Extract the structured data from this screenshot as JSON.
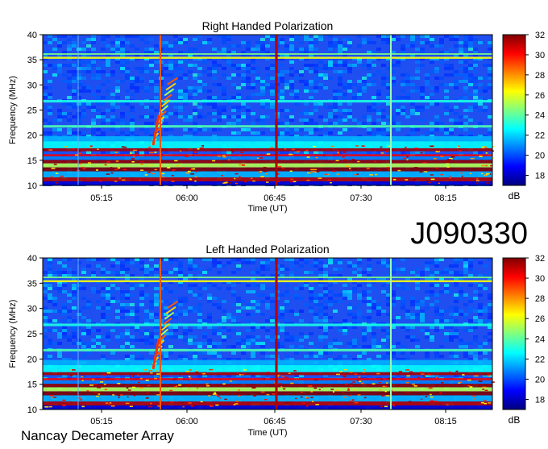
{
  "chart_data": [
    {
      "type": "heatmap",
      "title": "Right Handed Polarization",
      "xlabel": "Time (UT)",
      "ylabel": "Frequency (MHz)",
      "x_ticks": [
        "05:15",
        "06:00",
        "06:45",
        "07:30",
        "08:15"
      ],
      "y_ticks": [
        10,
        15,
        20,
        25,
        30,
        35,
        40
      ],
      "ylim": [
        10,
        40
      ],
      "colorbar": {
        "ticks": [
          18,
          20,
          22,
          24,
          26,
          28,
          30,
          32
        ],
        "range": [
          17,
          32
        ],
        "unit": "dB"
      }
    },
    {
      "type": "heatmap",
      "title": "Left Handed Polarization",
      "xlabel": "Time (UT)",
      "ylabel": "Frequency (MHz)",
      "x_ticks": [
        "05:15",
        "06:00",
        "06:45",
        "07:30",
        "08:15"
      ],
      "y_ticks": [
        10,
        15,
        20,
        25,
        30,
        35,
        40
      ],
      "ylim": [
        10,
        40
      ],
      "colorbar": {
        "ticks": [
          18,
          20,
          22,
          24,
          26,
          28,
          30,
          32
        ],
        "range": [
          17,
          32
        ],
        "unit": "dB"
      }
    }
  ],
  "observation_id": "J090330",
  "observatory": "Nancay Decameter Array"
}
